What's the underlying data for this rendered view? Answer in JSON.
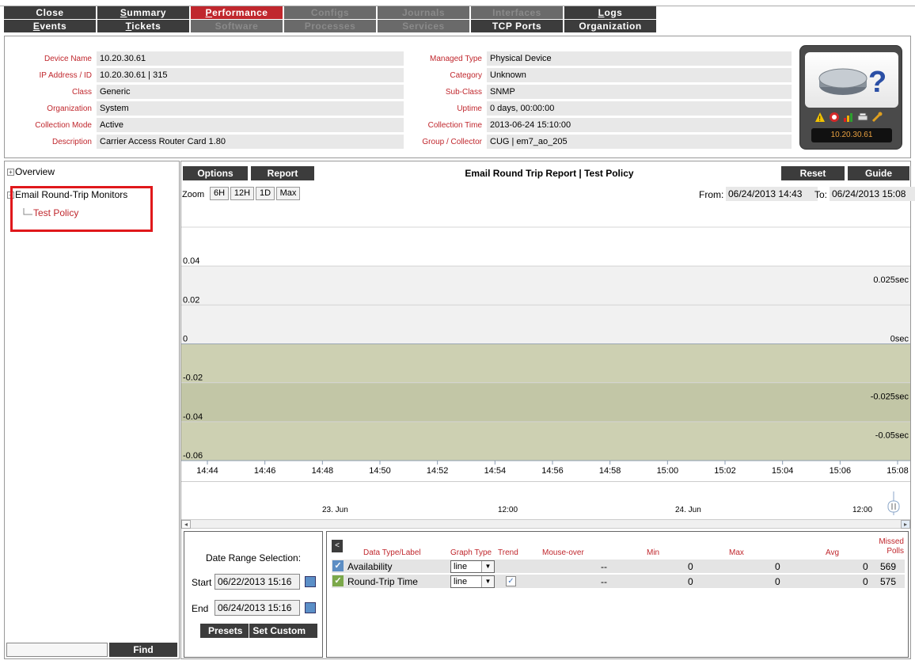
{
  "tabs": {
    "row1": [
      {
        "label": "Close",
        "state": "normal"
      },
      {
        "label": "Summary",
        "state": "normal"
      },
      {
        "label": "Performance",
        "state": "active"
      },
      {
        "label": "Configs",
        "state": "disabled"
      },
      {
        "label": "Journals",
        "state": "disabled"
      },
      {
        "label": "Interfaces",
        "state": "disabled"
      },
      {
        "label": "Logs",
        "state": "normal"
      }
    ],
    "row2": [
      {
        "label": "Events",
        "state": "normal"
      },
      {
        "label": "Tickets",
        "state": "normal"
      },
      {
        "label": "Software",
        "state": "disabled"
      },
      {
        "label": "Processes",
        "state": "disabled"
      },
      {
        "label": "Services",
        "state": "disabled"
      },
      {
        "label": "TCP Ports",
        "state": "normal"
      },
      {
        "label": "Organization",
        "state": "normal"
      }
    ]
  },
  "device": {
    "left": [
      {
        "label": "Device Name",
        "value": "10.20.30.61"
      },
      {
        "label": "IP Address / ID",
        "value": "10.20.30.61 | 315"
      },
      {
        "label": "Class",
        "value": "Generic"
      },
      {
        "label": "Organization",
        "value": "System"
      },
      {
        "label": "Collection Mode",
        "value": "Active"
      },
      {
        "label": "Description",
        "value": "Carrier Access Router Card 1.80"
      }
    ],
    "right": [
      {
        "label": "Managed Type",
        "value": "Physical Device"
      },
      {
        "label": "Category",
        "value": "Unknown"
      },
      {
        "label": "Sub-Class",
        "value": "SNMP"
      },
      {
        "label": "Uptime",
        "value": "0 days, 00:00:00"
      },
      {
        "label": "Collection Time",
        "value": "2013-06-24 15:10:00"
      },
      {
        "label": "Group / Collector",
        "value": "CUG | em7_ao_205"
      }
    ],
    "icon_ip": "10.20.30.61"
  },
  "tree": {
    "overview": "Overview",
    "monitors": "Email Round-Trip Monitors",
    "policy": "Test Policy",
    "find_label": "Find"
  },
  "graph": {
    "options_label": "Options",
    "report_label": "Report",
    "title": "Email Round Trip Report | Test Policy",
    "reset_label": "Reset",
    "guide_label": "Guide",
    "zoom_label": "Zoom",
    "zoom_options": [
      "6H",
      "12H",
      "1D",
      "Max"
    ],
    "from_label": "From:",
    "from_value": "06/24/2013 14:43",
    "to_label": "To:",
    "to_value": "06/24/2013 15:08",
    "navigator_labels": [
      "23. Jun",
      "12:00",
      "24. Jun",
      "12:00"
    ]
  },
  "chart_data": {
    "type": "line",
    "title": "Email Round Trip Report | Test Policy",
    "x_ticks": [
      "14:44",
      "14:46",
      "14:48",
      "14:50",
      "14:52",
      "14:54",
      "14:56",
      "14:58",
      "15:00",
      "15:02",
      "15:04",
      "15:06",
      "15:08"
    ],
    "left_axis": {
      "ticks": [
        0.04,
        0.02,
        0,
        -0.02,
        -0.04,
        -0.06
      ],
      "labels": [
        "0.04",
        "0.02",
        "0",
        "-0.02",
        "-0.04",
        "-0.06"
      ],
      "range": [
        -0.06,
        0.06
      ]
    },
    "right_axis": {
      "labels": [
        "0.025sec",
        "0sec",
        "-0.025sec",
        "-0.05sec"
      ]
    },
    "series": []
  },
  "date_range": {
    "title": "Date Range Selection:",
    "start_label": "Start",
    "start_value": "06/22/2013 15:16",
    "end_label": "End",
    "end_value": "06/24/2013 15:16",
    "presets_label": "Presets",
    "custom_label": "Set Custom"
  },
  "data_table": {
    "headers": {
      "label": "Data Type/Label",
      "graph_type": "Graph Type",
      "trend": "Trend",
      "mouseover": "Mouse-over",
      "min": "Min",
      "max": "Max",
      "avg": "Avg",
      "missed": "Missed Polls"
    },
    "rows": [
      {
        "label": "Availability",
        "graph_type": "line",
        "trend": false,
        "mouseover": "--",
        "min": "0",
        "max": "0",
        "avg": "0",
        "missed": "569"
      },
      {
        "label": "Round-Trip Time",
        "graph_type": "line",
        "trend": true,
        "mouseover": "--",
        "min": "0",
        "max": "0",
        "avg": "0",
        "missed": "575"
      }
    ]
  },
  "colors": {
    "tab_bg": "#3c3c3c",
    "tab_active": "#c0272d",
    "label_red": "#c0272d",
    "negative_band": "#c9ccac"
  }
}
